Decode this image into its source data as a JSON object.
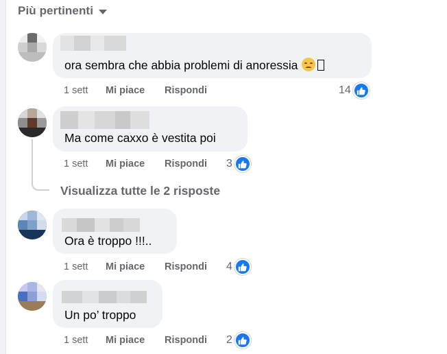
{
  "sort": {
    "label": "Più pertinenti",
    "icon": "caret-down-icon"
  },
  "like_badge_color": "#1877f2",
  "comments": [
    {
      "text": "ora sembra che abbia problemi di anoressia",
      "emoji": "pensive-face-emoji",
      "time": "1 sett",
      "like_label": "Mi piace",
      "reply_label": "Rispondi",
      "reactions": "14"
    },
    {
      "text": "Ma come caxxo è vestita poi",
      "time": "1 sett",
      "like_label": "Mi piace",
      "reply_label": "Rispondi",
      "reactions": "3",
      "view_replies": "Visualizza tutte le 2 risposte"
    },
    {
      "text": "Ora è troppo !!!..",
      "time": "1 sett",
      "like_label": "Mi piace",
      "reply_label": "Rispondi",
      "reactions": "4"
    },
    {
      "text": "Un po’ troppo",
      "time": "1 sett",
      "like_label": "Mi piace",
      "reply_label": "Rispondi",
      "reactions": "2"
    }
  ]
}
